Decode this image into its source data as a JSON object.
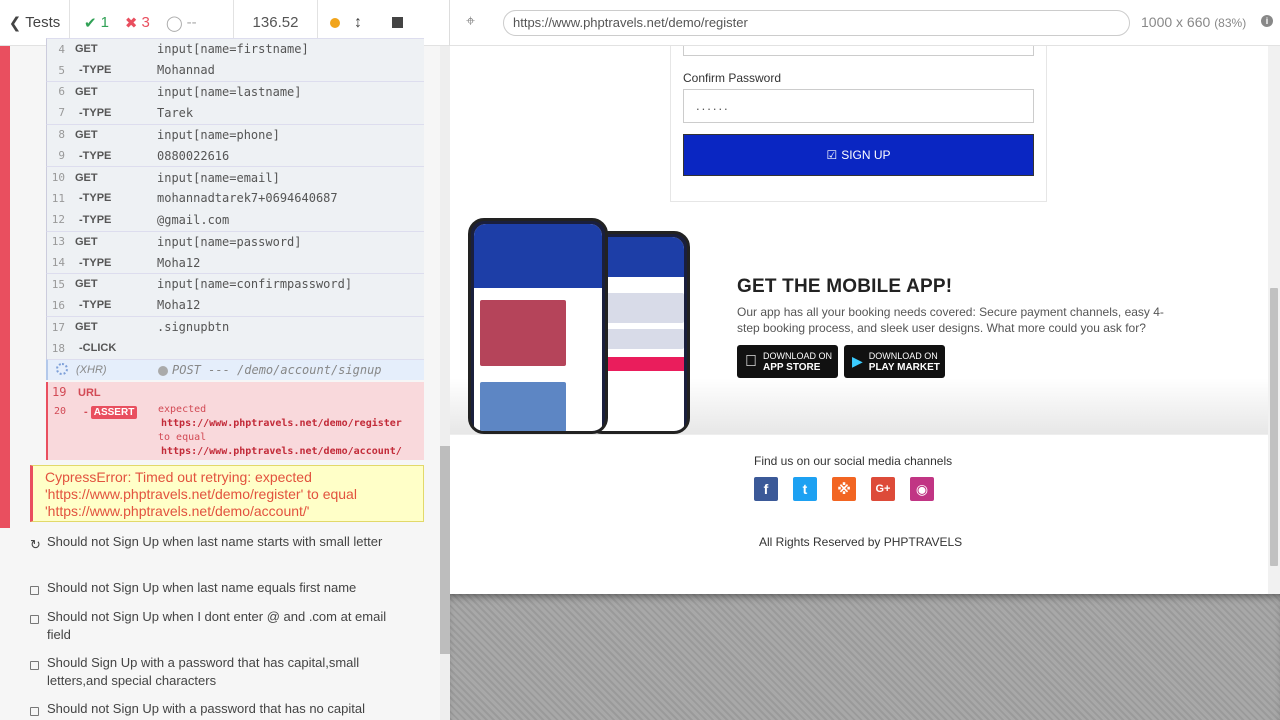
{
  "reporter": {
    "tests_label": "Tests",
    "passed_count": "1",
    "failed_count": "3",
    "pending_count": "--",
    "duration": "136.52",
    "commands": [
      {
        "num": "4",
        "name": "GET",
        "msg": "input[name=firstname]",
        "child": false
      },
      {
        "num": "5",
        "name": "-TYPE",
        "msg": "Mohannad",
        "child": true
      },
      {
        "num": "6",
        "name": "GET",
        "msg": "input[name=lastname]",
        "child": false
      },
      {
        "num": "7",
        "name": "-TYPE",
        "msg": "Tarek",
        "child": true
      },
      {
        "num": "8",
        "name": "GET",
        "msg": "input[name=phone]",
        "child": false
      },
      {
        "num": "9",
        "name": "-TYPE",
        "msg": "0880022616",
        "child": true
      },
      {
        "num": "10",
        "name": "GET",
        "msg": "input[name=email]",
        "child": false
      },
      {
        "num": "11",
        "name": "-TYPE",
        "msg": "mohannadtarek7+0694640687",
        "child": true
      },
      {
        "num": "12",
        "name": "-TYPE",
        "msg": "@gmail.com",
        "child": true
      },
      {
        "num": "13",
        "name": "GET",
        "msg": "input[name=password]",
        "child": false
      },
      {
        "num": "14",
        "name": "-TYPE",
        "msg": "Moha12",
        "child": true
      },
      {
        "num": "15",
        "name": "GET",
        "msg": "input[name=confirmpassword]",
        "child": false
      },
      {
        "num": "16",
        "name": "-TYPE",
        "msg": "Moha12",
        "child": true
      },
      {
        "num": "17",
        "name": "GET",
        "msg": ".signupbtn",
        "child": false
      },
      {
        "num": "18",
        "name": "-CLICK",
        "msg": "",
        "child": true
      }
    ],
    "xhr": {
      "name": "(XHR)",
      "msg": "POST --- /demo/account/signup"
    },
    "fail": {
      "url_num": "19",
      "url_name": "URL",
      "assert_num": "20",
      "assert_name": "ASSERT",
      "expected_label": "expected",
      "expected_value": "https://www.phptravels.net/demo/register",
      "to_equal_label": "to equal",
      "equal_value": "https://www.phptravels.net/demo/account/"
    },
    "error_message": "CypressError: Timed out retrying: expected 'https://www.phptravels.net/demo/register' to equal 'https://www.phptravels.net/demo/account/'",
    "tests": [
      "Should not Sign Up when last name starts with small letter",
      "Should not Sign Up when last name equals first name",
      "Should not Sign Up when I dont enter @ and .com at email field",
      "Should Sign Up with a password that has capital,small letters,and special characters",
      "Should not Sign Up with a password that has no capital"
    ]
  },
  "aut": {
    "url": "https://www.phptravels.net/demo/register",
    "viewport": "1000 x 660",
    "scale": "(83%)",
    "confirm_label": "Confirm Password",
    "confirm_value": "......",
    "signup_label": "SIGN UP",
    "app_title": "GET THE MOBILE APP!",
    "app_desc": "Our app has all your booking needs covered: Secure payment channels, easy 4-step booking process, and sleek user designs. What more could you ask for?",
    "app_store_small": "DOWNLOAD ON",
    "app_store_big": "APP STORE",
    "play_small": "DOWNLOAD ON",
    "play_big": "PLAY MARKET",
    "social_title": "Find us on our social media channels",
    "copyright": "All Rights Reserved by PHPTRAVELS",
    "colors": {
      "facebook": "#3b5998",
      "twitter": "#1da1f2",
      "rss": "#f26522",
      "google": "#dd4b39",
      "instagram": "#c13584",
      "signup": "#0a26c2"
    }
  }
}
